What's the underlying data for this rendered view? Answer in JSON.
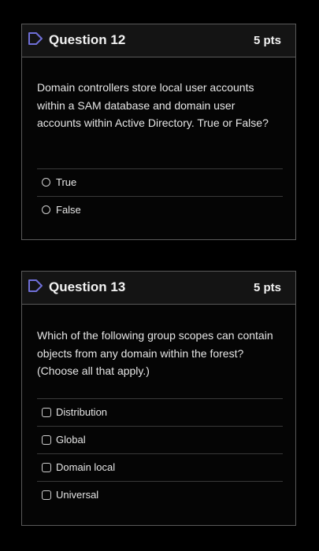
{
  "questions": [
    {
      "title": "Question 12",
      "points": "5 pts",
      "text": "Domain controllers store local user accounts within a SAM database and domain user accounts within Active Directory. True or False?",
      "answer_type": "radio",
      "answers": [
        "True",
        "False"
      ]
    },
    {
      "title": "Question 13",
      "points": "5 pts",
      "text": "Which of the following group scopes can contain objects from any domain within the forest? (Choose all that apply.)",
      "answer_type": "checkbox",
      "answers": [
        "Distribution",
        "Global",
        "Domain local",
        "Universal"
      ]
    }
  ],
  "colors": {
    "background": "#000000",
    "border": "#5a5a5a",
    "text": "#e6e6e6"
  },
  "icons": {
    "flag": "flag-icon"
  }
}
